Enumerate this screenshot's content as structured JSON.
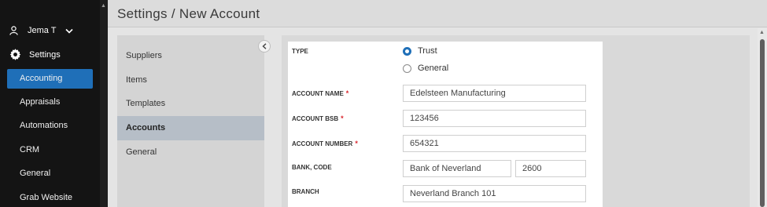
{
  "sidebar": {
    "user_name": "Jema T",
    "settings_label": "Settings",
    "items": [
      {
        "label": "Accounting",
        "active": true
      },
      {
        "label": "Appraisals",
        "active": false
      },
      {
        "label": "Automations",
        "active": false
      },
      {
        "label": "CRM",
        "active": false
      },
      {
        "label": "General",
        "active": false
      },
      {
        "label": "Grab Website",
        "active": false
      }
    ]
  },
  "header": {
    "title": "Settings / New Account"
  },
  "submenu": {
    "items": [
      {
        "label": "Suppliers",
        "active": false
      },
      {
        "label": "Items",
        "active": false
      },
      {
        "label": "Templates",
        "active": false
      },
      {
        "label": "Accounts",
        "active": true
      },
      {
        "label": "General",
        "active": false
      }
    ]
  },
  "form": {
    "type_label": "TYPE",
    "type_options": [
      {
        "label": "Trust",
        "selected": true
      },
      {
        "label": "General",
        "selected": false
      }
    ],
    "account_name_label": "ACCOUNT NAME",
    "account_name_value": "Edelsteen Manufacturing",
    "account_bsb_label": "ACCOUNT BSB",
    "account_bsb_value": "123456",
    "account_number_label": "ACCOUNT NUMBER",
    "account_number_value": "654321",
    "bank_code_label": "BANK, CODE",
    "bank_value": "Bank of Neverland",
    "code_value": "2600",
    "branch_label": "BRANCH",
    "branch_value": "Neverland Branch 101",
    "required_marker": "*"
  },
  "colors": {
    "accent": "#1f6fb8",
    "required": "#d9262e",
    "sidebar_bg": "#141414"
  }
}
